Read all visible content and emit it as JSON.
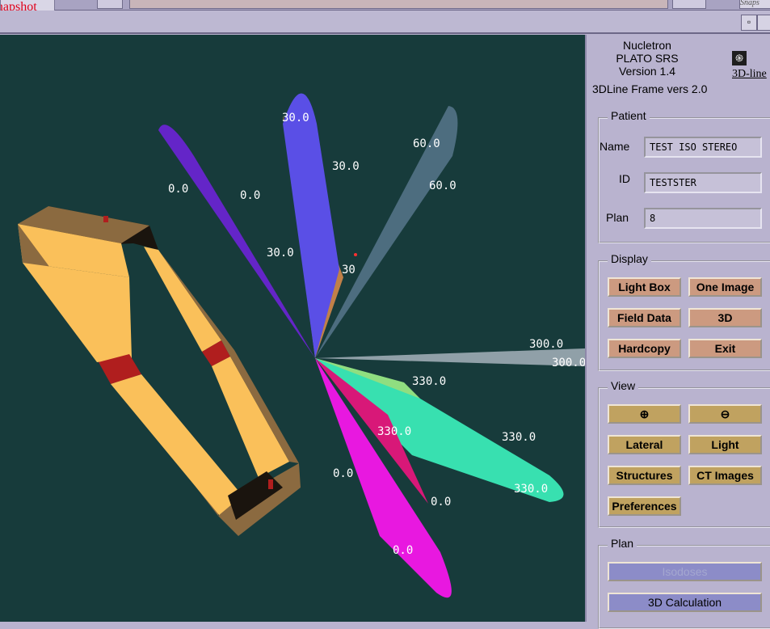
{
  "window": {
    "snapshot_button": "Snapshot",
    "snap_tab": "Snaps",
    "control_glyph": "▫"
  },
  "viewport": {
    "beam_labels": [
      "0.0",
      "0.0",
      "30.0",
      "30.0",
      "30.0",
      "30",
      "60.0",
      "60.0",
      "300.0",
      "300.0",
      "330.0",
      "330.0",
      "330.0",
      "330.0",
      "0.0",
      "0.0",
      "0.0"
    ],
    "colors": {
      "background": "#173b3b",
      "beam_violet": "#6425c8",
      "beam_blue": "#5a4fe6",
      "beam_tan": "#c08048",
      "beam_slate": "#4d6d7f",
      "beam_grey": "#90a0a8",
      "beam_green": "#90de80",
      "beam_cyan": "#38e0b0",
      "beam_magenta": "#e818e0",
      "beam_pink": "#d81878",
      "frame_gold": "#fac05a",
      "frame_edge": "#8b6a40",
      "frame_red": "#b01e1e"
    }
  },
  "panel": {
    "app_name": "Nucletron",
    "product": "PLATO SRS",
    "version": "Version 1.4",
    "logo_glyph": "֍",
    "logo_link": "3D-line",
    "frame_version": "3DLine Frame vers 2.0",
    "patient": {
      "title": "Patient",
      "name_label": "Name",
      "name_value": "TEST  ISO  STEREO",
      "id_label": "ID",
      "id_value": "TESTSTER",
      "plan_label": "Plan",
      "plan_value": "8"
    },
    "display": {
      "title": "Display",
      "light_box": "Light Box",
      "one_image": "One Image",
      "field_data": "Field Data",
      "three_d": "3D",
      "hardcopy": "Hardcopy",
      "exit": "Exit"
    },
    "view": {
      "title": "View",
      "zoom_in_icon": "⊕",
      "zoom_out_icon": "⊖",
      "lateral": "Lateral",
      "light": "Light",
      "structures": "Structures",
      "ct_images": "CT Images",
      "preferences": "Preferences"
    },
    "plan": {
      "title": "Plan",
      "isodoses": "Isodoses",
      "calc_3d": "3D Calculation"
    }
  }
}
